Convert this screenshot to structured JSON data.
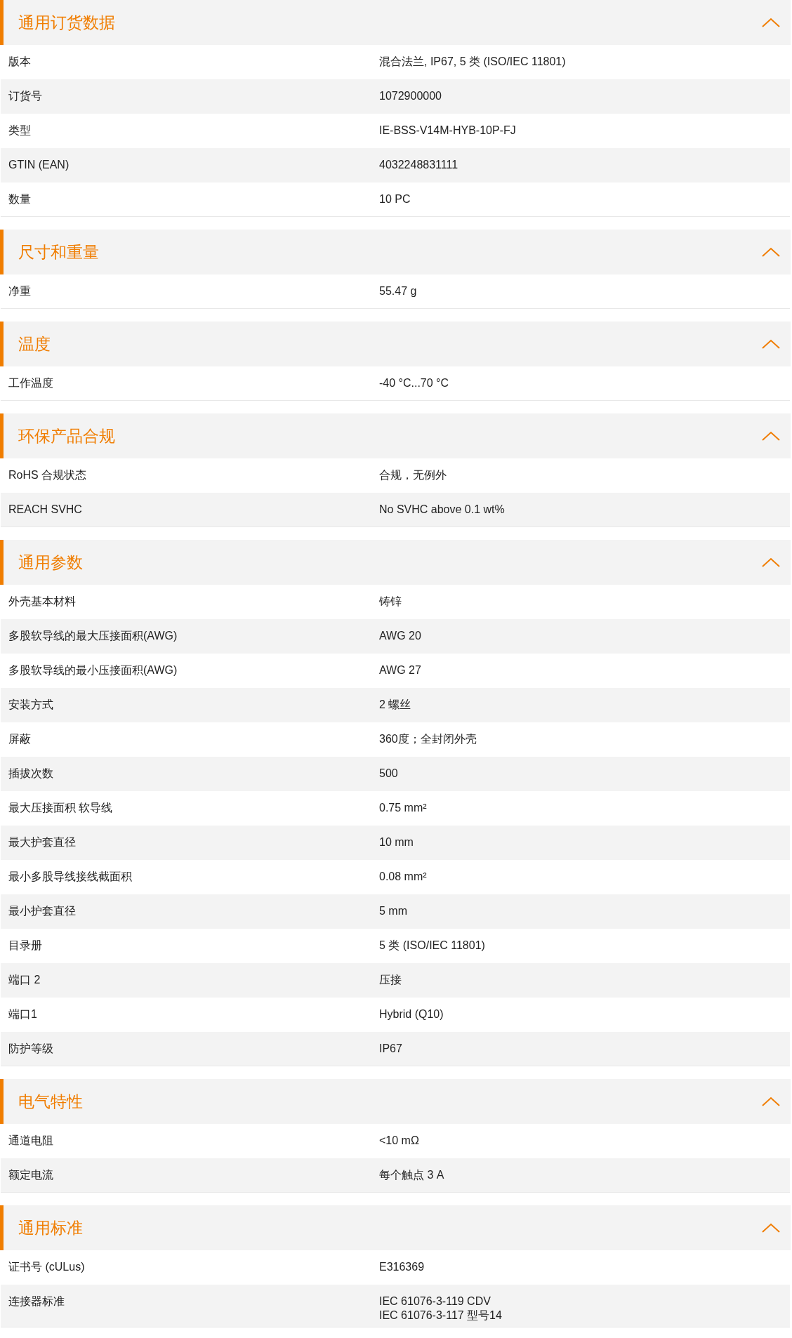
{
  "sections": [
    {
      "title": "通用订货数据",
      "expanded": true,
      "rows": [
        {
          "label": "版本",
          "value": "混合法兰, IP67, 5 类 (ISO/IEC 11801)"
        },
        {
          "label": "订货号",
          "value": "1072900000"
        },
        {
          "label": "类型",
          "value": "IE-BSS-V14M-HYB-10P-FJ"
        },
        {
          "label": "GTIN (EAN)",
          "value": "4032248831111"
        },
        {
          "label": "数量",
          "value": "10  PC"
        }
      ]
    },
    {
      "title": "尺寸和重量",
      "expanded": true,
      "rows": [
        {
          "label": "净重",
          "value": "55.47  g"
        }
      ]
    },
    {
      "title": "温度",
      "expanded": true,
      "rows": [
        {
          "label": "工作温度",
          "value": "-40 °C...70 °C"
        }
      ]
    },
    {
      "title": "环保产品合规",
      "expanded": true,
      "rows": [
        {
          "label": "RoHS 合规状态",
          "value": "合规，无例外"
        },
        {
          "label": "REACH SVHC",
          "value": "No SVHC above 0.1 wt%"
        }
      ]
    },
    {
      "title": "通用参数",
      "expanded": true,
      "rows": [
        {
          "label": "外壳基本材料",
          "value": "铸锌"
        },
        {
          "label": "多股软导线的最大压接面积(AWG)",
          "value": "AWG 20"
        },
        {
          "label": "多股软导线的最小压接面积(AWG)",
          "value": "AWG 27"
        },
        {
          "label": "安装方式",
          "value": "2 螺丝"
        },
        {
          "label": "屏蔽",
          "value": "360度；全封闭外壳"
        },
        {
          "label": "插拔次数",
          "value": "500"
        },
        {
          "label": "最大压接面积 软导线",
          "value": "0.75  mm²"
        },
        {
          "label": "最大护套直径",
          "value": "10  mm"
        },
        {
          "label": "最小多股导线接线截面积",
          "value": "0.08  mm²"
        },
        {
          "label": "最小护套直径",
          "value": "5  mm"
        },
        {
          "label": "目录册",
          "value": "5 类 (ISO/IEC 11801)"
        },
        {
          "label": "端口 2",
          "value": "压接"
        },
        {
          "label": "端口1",
          "value": "Hybrid (Q10)"
        },
        {
          "label": "防护等级",
          "value": "IP67"
        }
      ]
    },
    {
      "title": "电气特性",
      "expanded": true,
      "rows": [
        {
          "label": "通道电阻",
          "value": "<10 mΩ"
        },
        {
          "label": "额定电流",
          "value": "每个触点 3 A"
        }
      ]
    },
    {
      "title": "通用标准",
      "expanded": true,
      "rows": [
        {
          "label": "证书号 (cULus)",
          "value": "E316369"
        },
        {
          "label": "连接器标准",
          "value": "IEC 61076-3-119 CDV\nIEC 61076-3-117 型号14"
        }
      ]
    }
  ]
}
